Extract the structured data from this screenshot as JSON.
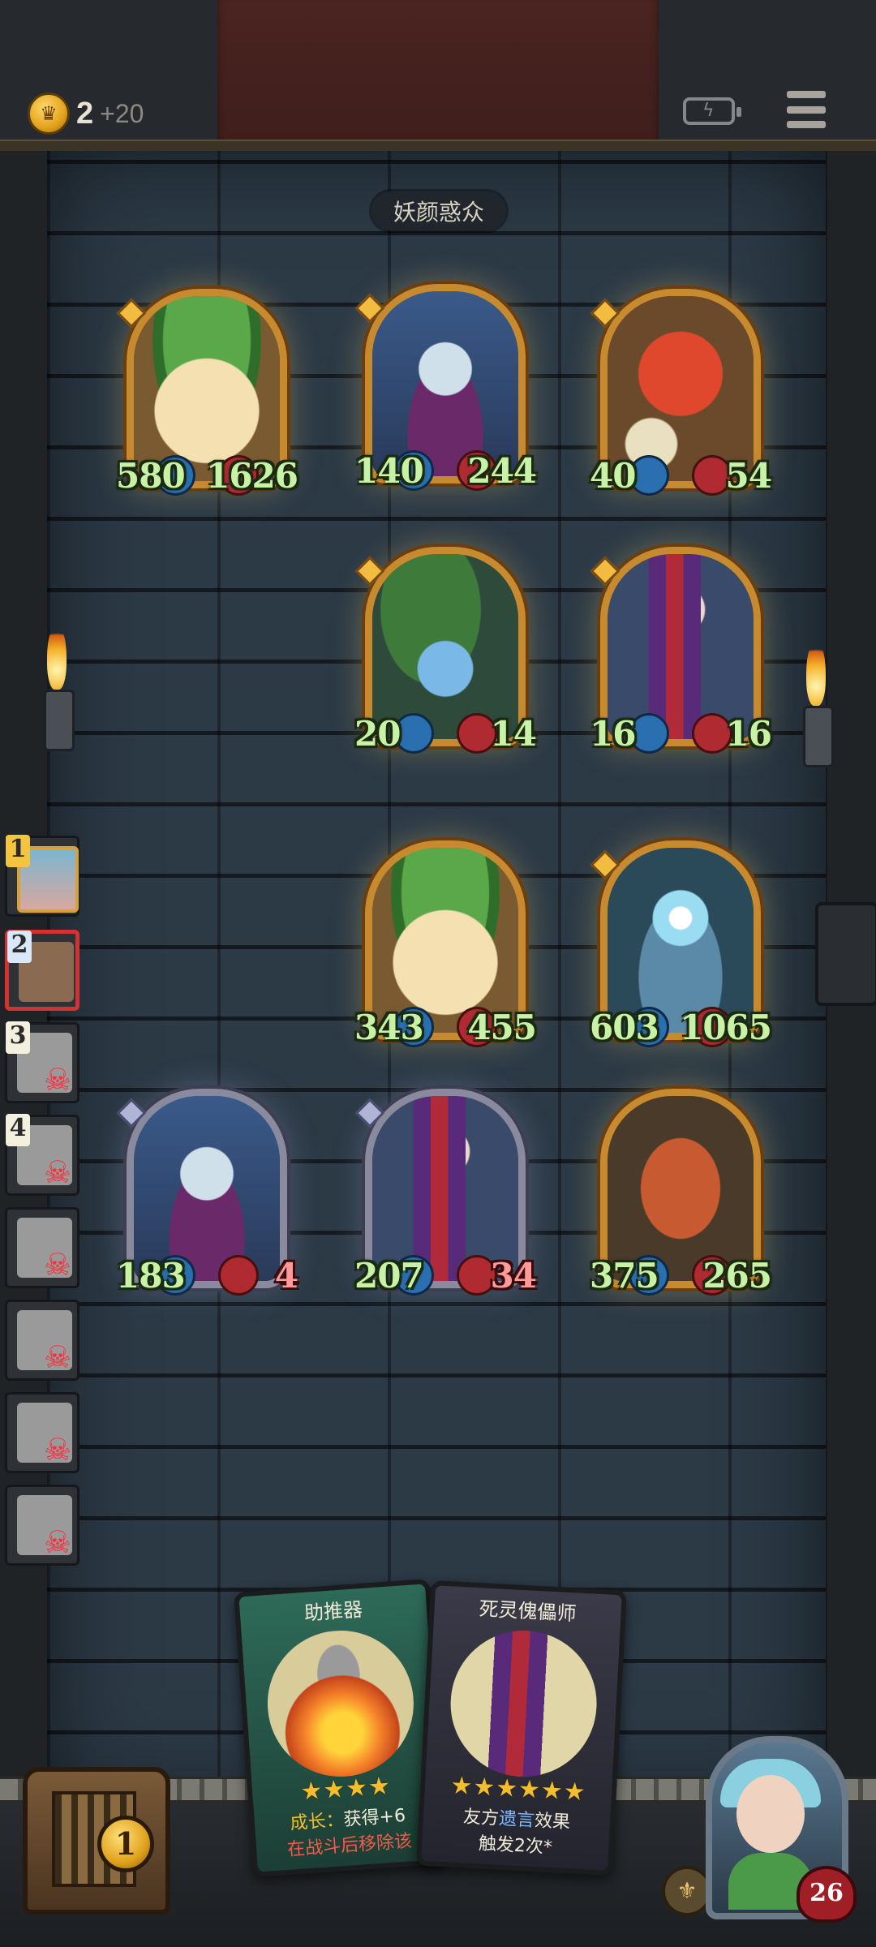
{
  "hud": {
    "coins": "2",
    "income": "+20",
    "coin_icon": "crown-coin-icon",
    "battery_icon": "battery-charging-icon",
    "menu_icon": "menu-icon"
  },
  "title": "妖颜惑众",
  "board": {
    "opponent_row": [
      {
        "name": "sprout",
        "atk": "580",
        "hp": "1626"
      },
      {
        "name": "elf",
        "atk": "140",
        "hp": "244"
      },
      {
        "name": "tomato",
        "atk": "40",
        "hp": "54"
      }
    ],
    "opponent_row2": [
      {
        "name": "vine",
        "atk": "20",
        "hp": "14"
      },
      {
        "name": "jester",
        "atk": "16",
        "hp": "16"
      }
    ],
    "player_row1": [
      {
        "name": "sprout",
        "atk": "343",
        "hp": "455"
      },
      {
        "name": "robot",
        "atk": "603",
        "hp": "1065"
      }
    ],
    "player_row2": [
      {
        "name": "elf",
        "atk": "183",
        "hp": "4"
      },
      {
        "name": "jester",
        "atk": "207",
        "hp": "34"
      },
      {
        "name": "box",
        "atk": "375",
        "hp": "265"
      }
    ]
  },
  "leaderboard": {
    "ranks": [
      "1",
      "2",
      "3",
      "4"
    ],
    "skull_icon": "skull-crossbones-icon"
  },
  "shop": {
    "tier": "1"
  },
  "cards": {
    "booster": {
      "name": "助推器",
      "stars": "★★★★",
      "growth_label": "成长：",
      "growth_text": "获得+6",
      "remove_text": "在战斗后移除该"
    },
    "puppet": {
      "name": "死灵傀儡师",
      "stars": "★★★★★★",
      "desc_pre": "友方",
      "desc_keyword": "遗言",
      "desc_post": "效果",
      "desc_line2": "触发2次*"
    }
  },
  "hero": {
    "hp": "26"
  },
  "colors": {
    "gold_frame": "#c88a2e",
    "silver_frame": "#8a8a9e",
    "stat_text": "#c8f2a6",
    "damaged_text": "#ff9a9a",
    "wall": "#2c3a46"
  }
}
